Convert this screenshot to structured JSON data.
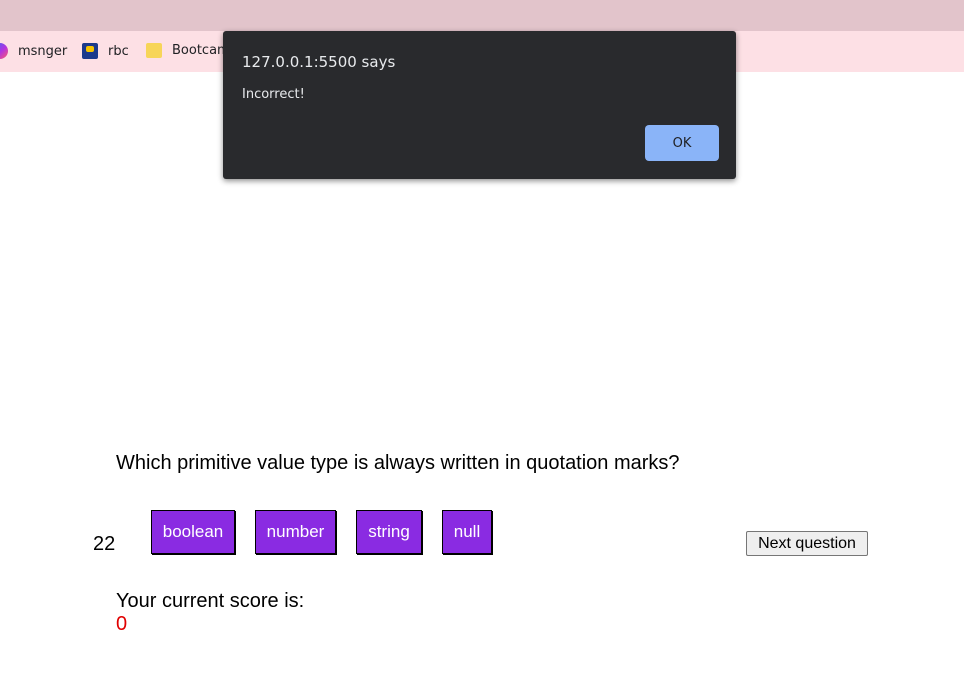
{
  "browser": {
    "bookmarks": [
      {
        "label": "msnger",
        "icon": "messenger-icon"
      },
      {
        "label": "rbc",
        "icon": "rbc-icon"
      },
      {
        "label": "Bootcam",
        "icon": "folder-icon"
      }
    ]
  },
  "alert": {
    "title": "127.0.0.1:5500 says",
    "message": "Incorrect!",
    "ok_label": "OK"
  },
  "quiz": {
    "question": "Which primitive value type is always written in quotation marks?",
    "counter": "22",
    "answers": [
      "boolean",
      "number",
      "string",
      "null"
    ],
    "next_label": "Next question",
    "score_label": "Your current score is:",
    "score_value": "0"
  },
  "colors": {
    "answer_bg": "#8a2be2",
    "score_value": "#e00000",
    "dialog_bg": "#292a2d",
    "ok_button": "#8ab4f8"
  }
}
